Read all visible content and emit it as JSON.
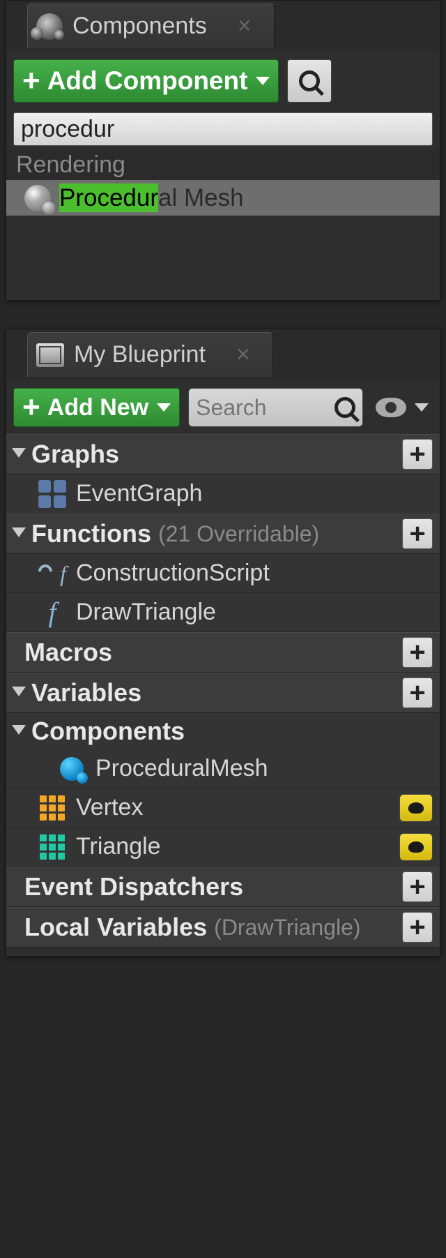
{
  "colors": {
    "accent_green": "#45b14a",
    "highlight": "#4cbf2e"
  },
  "components_panel": {
    "tab_title": "Components",
    "add_button_label": "Add Component",
    "search_value": "procedur",
    "results": {
      "category": "Rendering",
      "item_highlight": "Procedur",
      "item_suffix": "al Mesh"
    }
  },
  "blueprint_panel": {
    "tab_title": "My Blueprint",
    "add_button_label": "Add New",
    "search_placeholder": "Search",
    "sections": {
      "graphs": {
        "title": "Graphs",
        "items": [
          "EventGraph"
        ]
      },
      "functions": {
        "title": "Functions",
        "sub": "(21 Overridable)",
        "items": [
          "ConstructionScript",
          "DrawTriangle"
        ]
      },
      "macros": {
        "title": "Macros"
      },
      "variables": {
        "title": "Variables"
      },
      "components": {
        "title": "Components",
        "items": [
          "ProceduralMesh",
          "Vertex",
          "Triangle"
        ]
      },
      "event_dispatchers": {
        "title": "Event Dispatchers"
      },
      "local_variables": {
        "title": "Local Variables",
        "sub": "(DrawTriangle)"
      }
    }
  }
}
